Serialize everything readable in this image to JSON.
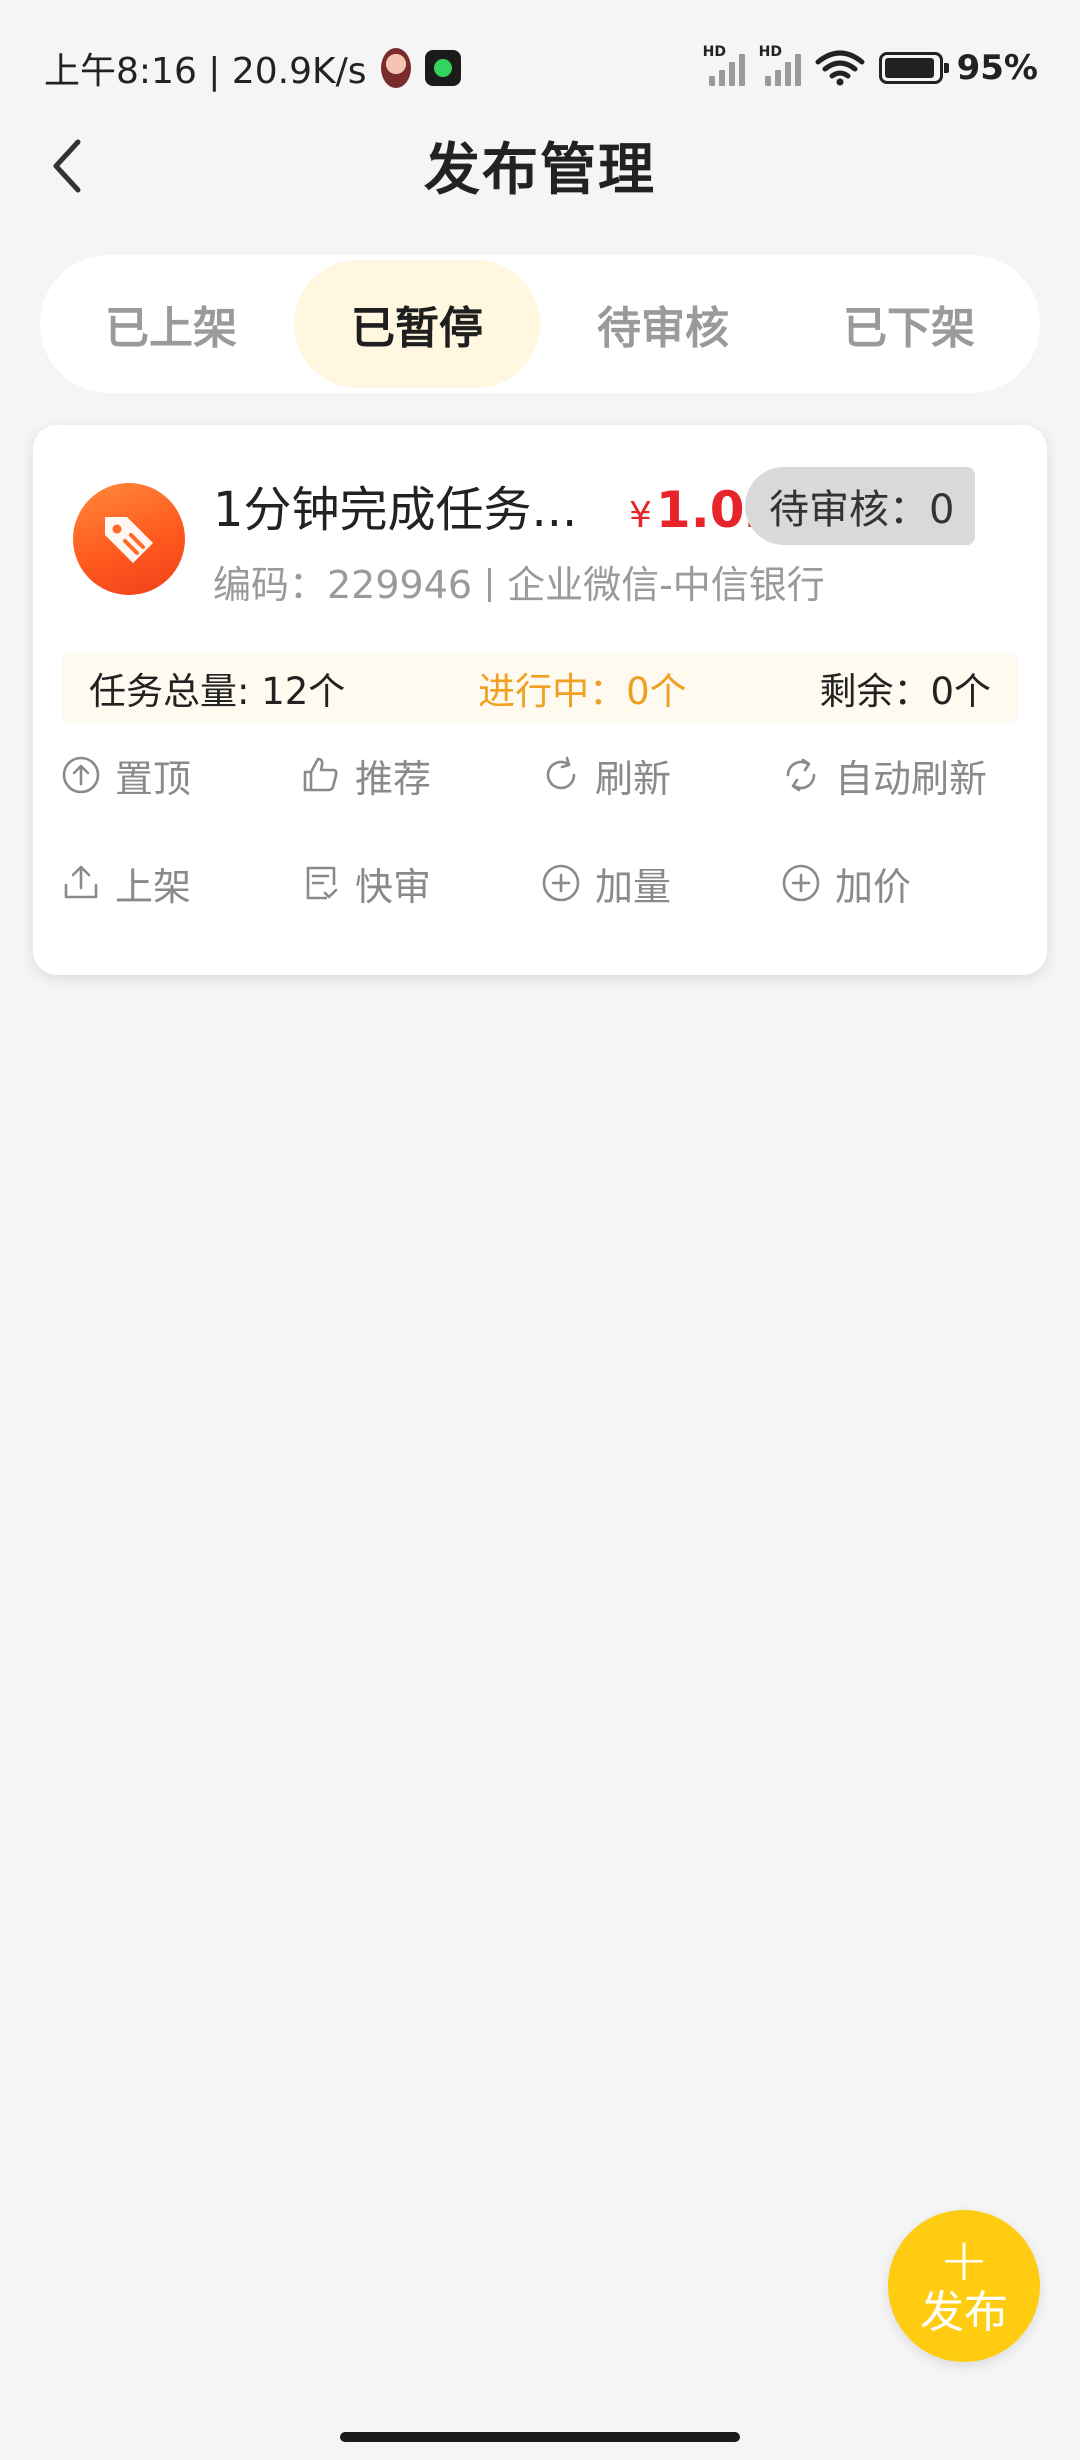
{
  "status_bar": {
    "time_speed": "上午8:16 | 20.9K/s",
    "signal_hd_1": "HD",
    "signal_hd_2": "HD",
    "battery_pct": "95%",
    "battery_level": 0.95
  },
  "header": {
    "title": "发布管理",
    "back_icon": "chevron-left-icon"
  },
  "tabs": [
    {
      "label": "已上架",
      "active": false
    },
    {
      "label": "已暂停",
      "active": true
    },
    {
      "label": "待审核",
      "active": false
    },
    {
      "label": "已下架",
      "active": false
    }
  ],
  "task_card": {
    "title": "1分钟完成任务...",
    "price_symbol": "¥",
    "price": "1.02",
    "pending_label": "待审核：0",
    "code": "编码：229946",
    "category": "企业微信-中信银行",
    "stats": {
      "total": "任务总量: 12个",
      "in_progress": "进行中：0个",
      "remaining": "剩余：0个"
    },
    "actions": [
      {
        "label": "置顶",
        "icon": "arrow-up-circle-icon"
      },
      {
        "label": "推荐",
        "icon": "thumbs-up-icon"
      },
      {
        "label": "刷新",
        "icon": "refresh-icon"
      },
      {
        "label": "自动刷新",
        "icon": "auto-refresh-icon"
      },
      {
        "label": "上架",
        "icon": "upload-icon"
      },
      {
        "label": "快审",
        "icon": "document-check-icon"
      },
      {
        "label": "加量",
        "icon": "plus-circle-icon"
      },
      {
        "label": "加价",
        "icon": "plus-circle-icon"
      }
    ]
  },
  "fab": {
    "plus": "+",
    "label": "发布"
  },
  "colors": {
    "accent_yellow": "#ffcc12",
    "price_red": "#e8242b",
    "progress_orange": "#f0a020",
    "active_tab_bg": "#fff7e0",
    "badge_gray": "#d9d9d9"
  }
}
